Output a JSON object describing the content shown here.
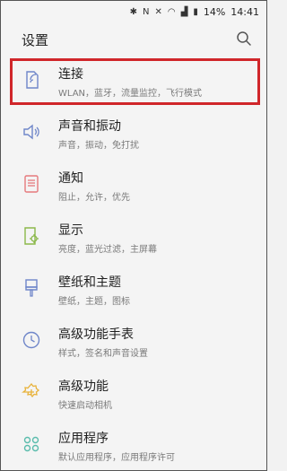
{
  "status_bar": {
    "battery": "14%",
    "time": "14:41"
  },
  "header": {
    "title": "设置"
  },
  "colors": {
    "icon_blue": "#6f86c9",
    "icon_pink": "#e5797d",
    "icon_green": "#8bb84a",
    "icon_yellow": "#e8b23a",
    "icon_teal": "#5bbcad",
    "highlight": "#d0262a"
  },
  "items": [
    {
      "label": "连接",
      "sub": "WLAN，蓝牙，流量监控，飞行模式",
      "icon": "connection-icon"
    },
    {
      "label": "声音和振动",
      "sub": "声音，振动，免打扰",
      "icon": "speaker-icon"
    },
    {
      "label": "通知",
      "sub": "阻止，允许，优先",
      "icon": "notification-icon"
    },
    {
      "label": "显示",
      "sub": "亮度，蓝光过滤，主屏幕",
      "icon": "display-icon"
    },
    {
      "label": "壁纸和主题",
      "sub": "壁纸，主题，图标",
      "icon": "brush-icon"
    },
    {
      "label": "高级功能手表",
      "sub": "样式，签名和声音设置",
      "icon": "clock-icon"
    },
    {
      "label": "高级功能",
      "sub": "快速启动相机",
      "icon": "gear-plus-icon"
    },
    {
      "label": "应用程序",
      "sub": "默认应用程序，应用程序许可",
      "icon": "apps-icon"
    }
  ]
}
